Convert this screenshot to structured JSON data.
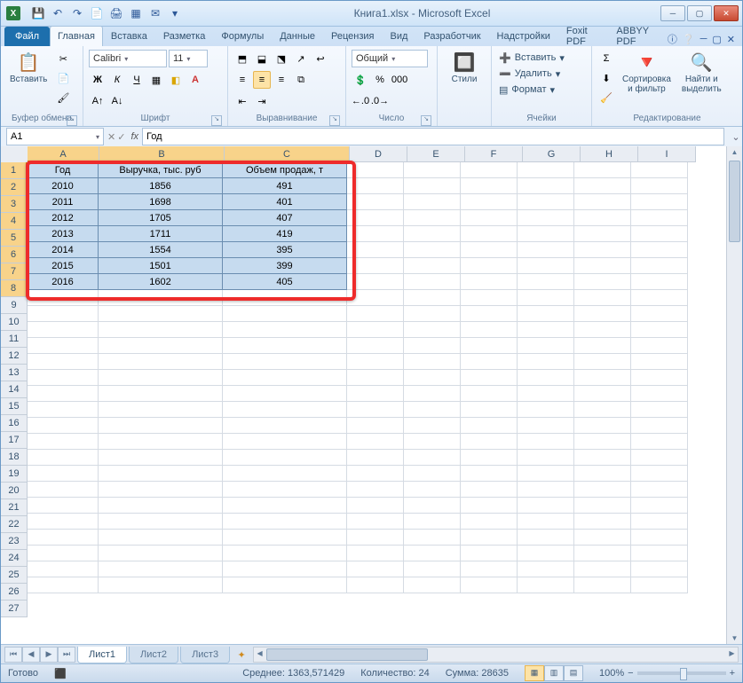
{
  "title": "Книга1.xlsx - Microsoft Excel",
  "qat": {
    "save": "💾",
    "undo": "↶",
    "redo": "↷"
  },
  "tabs": {
    "file": "Файл",
    "items": [
      "Главная",
      "Вставка",
      "Разметка",
      "Формулы",
      "Данные",
      "Рецензия",
      "Вид",
      "Разработчик",
      "Надстройки",
      "Foxit PDF",
      "ABBYY PDF"
    ],
    "active": 0
  },
  "ribbon": {
    "clipboard": {
      "paste": "Вставить",
      "label": "Буфер обмена"
    },
    "font": {
      "name": "Calibri",
      "size": "11",
      "label": "Шрифт"
    },
    "align": {
      "label": "Выравнивание"
    },
    "number": {
      "format": "Общий",
      "label": "Число"
    },
    "styles": {
      "btn": "Стили"
    },
    "cells": {
      "insert": "Вставить",
      "delete": "Удалить",
      "format": "Формат",
      "label": "Ячейки"
    },
    "editing": {
      "sort": "Сортировка\nи фильтр",
      "find": "Найти и\nвыделить",
      "label": "Редактирование"
    }
  },
  "namebox": "A1",
  "formula": "Год",
  "cols": [
    "A",
    "B",
    "C",
    "D",
    "E",
    "F",
    "G",
    "H",
    "I"
  ],
  "rows": [
    1,
    2,
    3,
    4,
    5,
    6,
    7,
    8,
    9,
    10,
    11,
    12,
    13,
    14,
    15,
    16,
    17,
    18,
    19,
    20,
    21,
    22,
    23,
    24,
    25,
    26,
    27
  ],
  "table": {
    "headers": [
      "Год",
      "Выручка, тыс. руб",
      "Объем продаж, т"
    ],
    "data": [
      [
        "2010",
        "1856",
        "491"
      ],
      [
        "2011",
        "1698",
        "401"
      ],
      [
        "2012",
        "1705",
        "407"
      ],
      [
        "2013",
        "1711",
        "419"
      ],
      [
        "2014",
        "1554",
        "395"
      ],
      [
        "2015",
        "1501",
        "399"
      ],
      [
        "2016",
        "1602",
        "405"
      ]
    ]
  },
  "sheets": {
    "active": "Лист1",
    "others": [
      "Лист2",
      "Лист3"
    ]
  },
  "status": {
    "ready": "Готово",
    "avg_l": "Среднее:",
    "avg_v": "1363,571429",
    "cnt_l": "Количество:",
    "cnt_v": "24",
    "sum_l": "Сумма:",
    "sum_v": "28635",
    "zoom": "100%"
  }
}
